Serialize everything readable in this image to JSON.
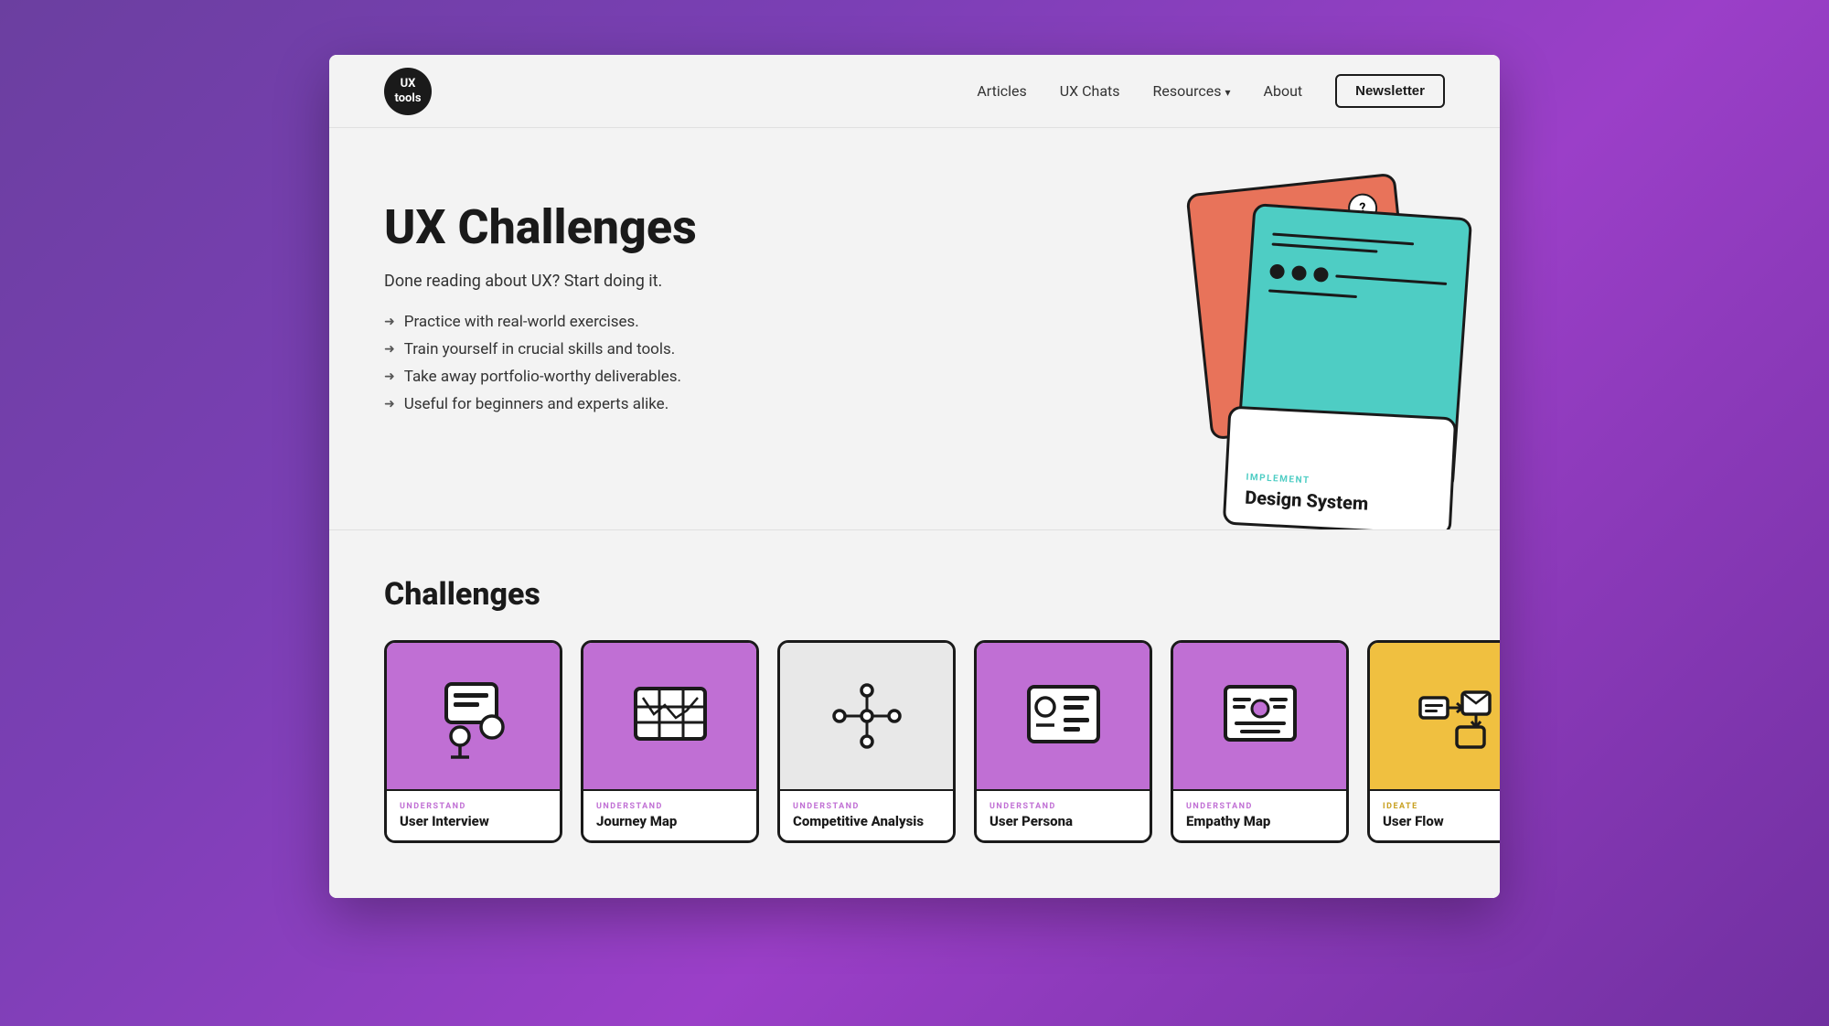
{
  "nav": {
    "logo_line1": "UX",
    "logo_line2": "tools",
    "links": [
      {
        "label": "Articles",
        "id": "articles"
      },
      {
        "label": "UX Chats",
        "id": "ux-chats"
      },
      {
        "label": "Resources",
        "id": "resources",
        "dropdown": true
      },
      {
        "label": "About",
        "id": "about"
      }
    ],
    "cta_label": "Newsletter"
  },
  "hero": {
    "title": "UX Challenges",
    "subtitle": "Done reading about UX? Start doing it.",
    "bullets": [
      "Practice with real-world exercises.",
      "Train yourself in crucial skills and tools.",
      "Take away portfolio-worthy deliverables.",
      "Useful for beginners and experts alike."
    ],
    "card_bottom_label": "IMPLEMENT",
    "card_bottom_title": "Design System"
  },
  "challenges": {
    "section_title": "Challenges",
    "cards": [
      {
        "id": "user-interview",
        "color": "purple",
        "category": "UNDERSTAND",
        "name": "User Interview"
      },
      {
        "id": "journey-map",
        "color": "purple",
        "category": "UNDERSTAND",
        "name": "Journey Map"
      },
      {
        "id": "competitive-analysis",
        "color": "white",
        "category": "UNDERSTAND",
        "name": "Competitive Analysis"
      },
      {
        "id": "user-persona",
        "color": "purple",
        "category": "UNDERSTAND",
        "name": "User Persona"
      },
      {
        "id": "empathy-map",
        "color": "purple",
        "category": "UNDERSTAND",
        "name": "Empathy Map"
      },
      {
        "id": "user-flow",
        "color": "yellow",
        "category": "IDEATE",
        "name": "User Flow"
      }
    ]
  }
}
